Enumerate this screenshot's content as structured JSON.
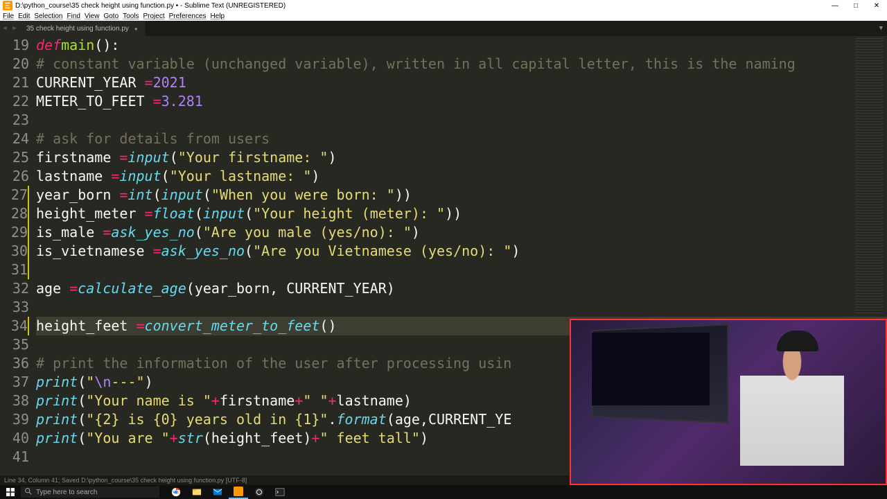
{
  "window": {
    "title": "D:\\python_course\\35 check height using function.py • - Sublime Text (UNREGISTERED)",
    "minimize": "—",
    "maximize": "□",
    "close": "✕"
  },
  "menu": {
    "file": "File",
    "edit": "Edit",
    "selection": "Selection",
    "find": "Find",
    "view": "View",
    "goto": "Goto",
    "tools": "Tools",
    "project": "Project",
    "preferences": "Preferences",
    "help": "Help"
  },
  "tab": {
    "name": "35 check height using function.py",
    "dirty": "●",
    "more": "▼",
    "back": "◀",
    "fwd": "▶"
  },
  "lines": {
    "start": 19,
    "count": 23,
    "cursor_line": 34,
    "modified": [
      27,
      28,
      29,
      30,
      31,
      34
    ]
  },
  "code": {
    "l19": {
      "kw": "def",
      "sp": " ",
      "fn": "main",
      "rest": "():"
    },
    "l20": {
      "indent": "    ",
      "cmt": "# constant variable (unchanged variable), written in all capital letter, this is the naming"
    },
    "l21": {
      "indent": "    ",
      "id": "CURRENT_YEAR ",
      "op": "=",
      "sp": " ",
      "num": "2021"
    },
    "l22": {
      "indent": "    ",
      "id": "METER_TO_FEET ",
      "op": "=",
      "sp": " ",
      "num": "3.281"
    },
    "l23": {
      "indent": ""
    },
    "l24": {
      "indent": "    ",
      "cmt": "# ask for details from users"
    },
    "l25": {
      "indent": "    ",
      "id": "firstname ",
      "op": "=",
      "sp": " ",
      "call": "input",
      "p1": "(",
      "str": "\"Your firstname: \"",
      "p2": ")"
    },
    "l26": {
      "indent": "    ",
      "id": "lastname ",
      "op": "=",
      "sp": " ",
      "call": "input",
      "p1": "(",
      "str": "\"Your lastname: \"",
      "p2": ")"
    },
    "l27": {
      "indent": "    ",
      "id": "year_born ",
      "op": "=",
      "sp": " ",
      "call": "int",
      "p1": "(",
      "call2": "input",
      "p2": "(",
      "str": "\"When you were born: \"",
      "p3": "))"
    },
    "l28": {
      "indent": "    ",
      "id": "height_meter ",
      "op": "=",
      "sp": " ",
      "call": "float",
      "p1": "(",
      "call2": "input",
      "p2": "(",
      "str": "\"Your height (meter): \"",
      "p3": "))"
    },
    "l29": {
      "indent": "    ",
      "id": "is_male ",
      "op": "=",
      "sp": " ",
      "call": "ask_yes_no",
      "p1": "(",
      "str": "\"Are you male (yes/no): \"",
      "p2": ")"
    },
    "l30": {
      "indent": "    ",
      "id": "is_vietnamese ",
      "op": "=",
      "sp": " ",
      "call": "ask_yes_no",
      "p1": "(",
      "str": "\"Are you Vietnamese (yes/no): \"",
      "p2": ")"
    },
    "l31": {
      "indent": ""
    },
    "l32": {
      "indent": "    ",
      "id": "age ",
      "op": "=",
      "sp": " ",
      "call": "calculate_age",
      "p1": "(",
      "args": "year_born, CURRENT_YEAR",
      "p2": ")"
    },
    "l33": {
      "indent": ""
    },
    "l34": {
      "indent": "    ",
      "id": "height_feet ",
      "op": "=",
      "sp": " ",
      "call": "convert_meter_to_feet",
      "p1": "()",
      "cursor": true
    },
    "l35": {
      "indent": ""
    },
    "l36": {
      "indent": "    ",
      "cmt": "# print the information of the user after processing usin"
    },
    "l37": {
      "indent": "    ",
      "call": "print",
      "p1": "(",
      "str1": "\"",
      "esc": "\\n",
      "str2": "---\"",
      "p2": ")"
    },
    "l38": {
      "indent": "    ",
      "call": "print",
      "p1": "(",
      "str": "\"Your name is \"",
      "sp": " ",
      "op": "+",
      "sp2": " ",
      "id": "firstname",
      "sp3": " ",
      "op2": "+",
      "sp4": " ",
      "str2": "\" \"",
      "sp5": " ",
      "op3": "+",
      "sp6": " ",
      "id2": "lastname",
      "p2": ")"
    },
    "l39": {
      "indent": "    ",
      "call": "print",
      "p1": "(",
      "str": "\"{2} is {0} years old in {1}\"",
      "dot": ".",
      "call2": "format",
      "p2": "(",
      "args": "age,CURRENT_YE"
    },
    "l40": {
      "indent": "    ",
      "call": "print",
      "p1": "(",
      "str": "\"You are \"",
      "sp": " ",
      "op": "+",
      "sp2": " ",
      "call2": "str",
      "p2": "(",
      "id": "height_feet",
      "p3": ")",
      "sp3": " ",
      "op2": "+",
      "sp4": " ",
      "str2": "\" feet tall\"",
      "p4": ")"
    },
    "l41": {
      "indent": ""
    }
  },
  "statusbar": {
    "text": "Line 34, Column 41; Saved D:\\python_course\\35 check height using function.py [UTF-8]"
  },
  "taskbar": {
    "search_placeholder": "Type here to search"
  }
}
